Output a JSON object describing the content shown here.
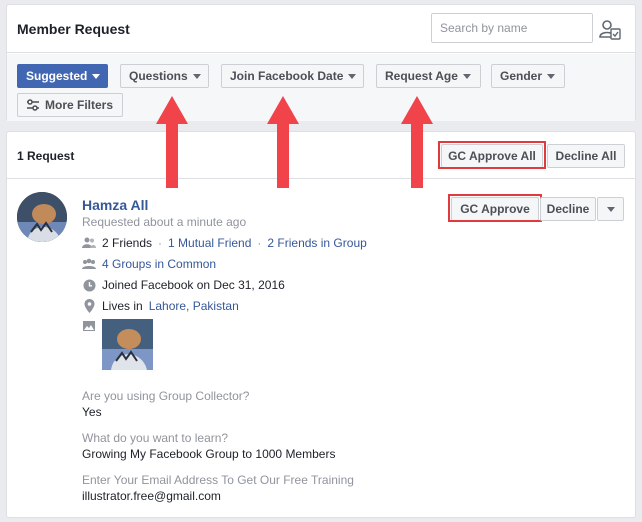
{
  "header": {
    "title": "Member Request",
    "search_placeholder": "Search by name"
  },
  "filters": [
    {
      "label": "Suggested",
      "primary": true
    },
    {
      "label": "Questions"
    },
    {
      "label": "Join Facebook Date"
    },
    {
      "label": "Request Age"
    },
    {
      "label": "Gender"
    },
    {
      "label": "More Filters"
    }
  ],
  "requests": {
    "count_label": "1 Request",
    "approve_all": "GC Approve All",
    "decline_all": "Decline All"
  },
  "member": {
    "name": "Hamza All",
    "requested": "Requested about a minute ago",
    "approve": "GC Approve",
    "decline": "Decline",
    "friends": "2 Friends",
    "mutual": "1 Mutual Friend",
    "friends_in_group": "2 Friends in Group",
    "groups_common": "4 Groups in Common",
    "joined": "Joined Facebook on Dec 31, 2016",
    "lives_prefix": "Lives in",
    "location": "Lahore, Pakistan",
    "separator": "·"
  },
  "answers": [
    {
      "question": "Are you using Group Collector?",
      "answer": "Yes"
    },
    {
      "question": "What do you want to learn?",
      "answer": "Growing My Facebook Group to 1000 Members"
    },
    {
      "question": "Enter Your Email Address To Get Our Free Training",
      "answer": "illustrator.free@gmail.com"
    }
  ],
  "colors": {
    "accent": "#4267b2",
    "link": "#365899",
    "annotation": "#f0434a"
  }
}
